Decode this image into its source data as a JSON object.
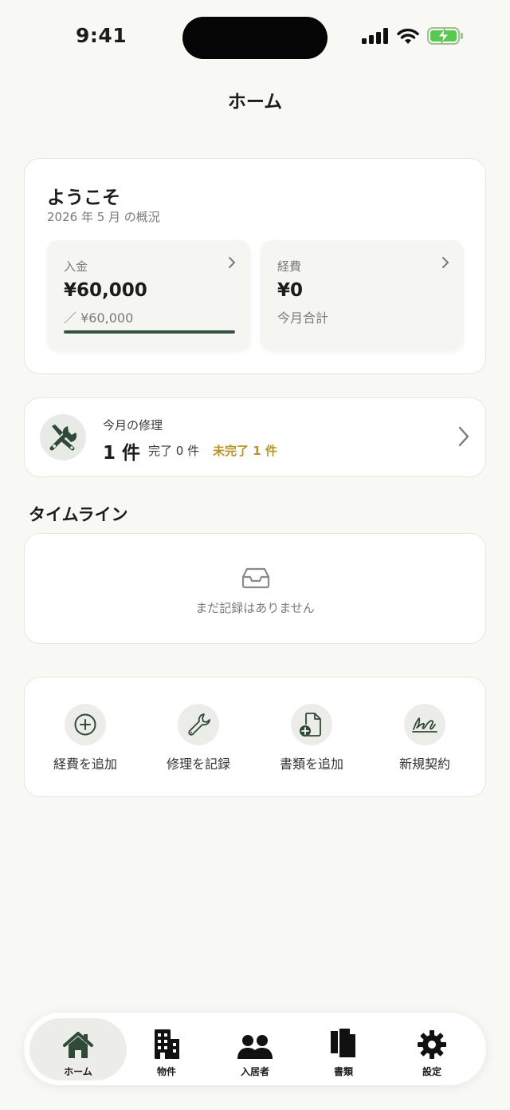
{
  "status_bar": {
    "time": "9:41"
  },
  "nav": {
    "title": "ホーム"
  },
  "welcome": {
    "title": "ようこそ",
    "subtitle": "2026 年 5 月 の概況",
    "income": {
      "label": "入金",
      "value": "¥60,000",
      "note": "／ ¥60,000",
      "progress": 1.0
    },
    "expense": {
      "label": "経費",
      "value": "¥0",
      "note": "今月合計"
    }
  },
  "repair": {
    "label": "今月の修理",
    "count": "1 件",
    "done": "完了 0 件",
    "pending": "未完了 1 件",
    "colors": {
      "pending": "#b89423"
    }
  },
  "timeline": {
    "title": "タイムライン",
    "empty_text": "まだ記録はありません"
  },
  "actions": [
    {
      "label": "経費を追加",
      "icon": "plus-circle-icon"
    },
    {
      "label": "修理を記録",
      "icon": "wrench-icon"
    },
    {
      "label": "書類を追加",
      "icon": "document-add-icon"
    },
    {
      "label": "新規契約",
      "icon": "signature-icon"
    }
  ],
  "tabs": [
    {
      "label": "ホーム",
      "icon": "home-icon",
      "active": true
    },
    {
      "label": "物件",
      "icon": "building-icon",
      "active": false
    },
    {
      "label": "入居者",
      "icon": "people-icon",
      "active": false
    },
    {
      "label": "書類",
      "icon": "documents-icon",
      "active": false
    },
    {
      "label": "設定",
      "icon": "gear-icon",
      "active": false
    }
  ],
  "colors": {
    "accent": "#37523f",
    "background": "#f8f8f4"
  }
}
